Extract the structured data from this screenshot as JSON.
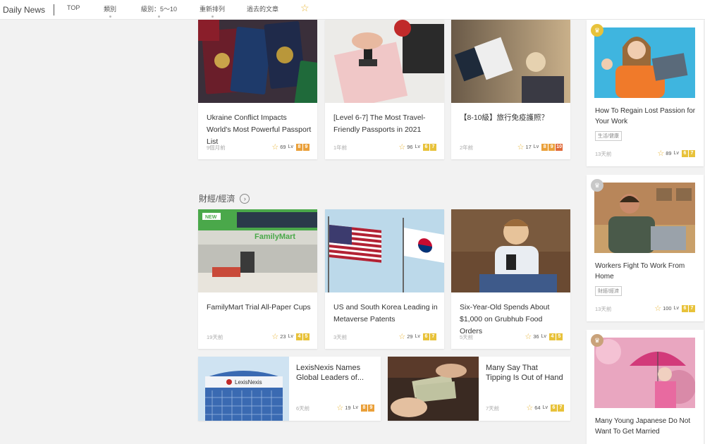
{
  "nav": {
    "brand": "Daily News",
    "items": [
      "TOP",
      "類別",
      "級別：5～10",
      "重新排列",
      "過去的文章"
    ],
    "star": "☆"
  },
  "top_cards": [
    {
      "title": "Ukraine Conflict Impacts World's Most Powerful Passport List",
      "ago": "9個月前",
      "rating": "69",
      "levels": [
        "8",
        "9"
      ]
    },
    {
      "title": "[Level 6-7] The Most Travel-Friendly Passports in 2021",
      "ago": "1年前",
      "rating": "96",
      "levels": [
        "6",
        "7"
      ]
    },
    {
      "title": "【8-10級】旅行免疫護照？",
      "ago": "2年前",
      "rating": "17",
      "levels": [
        "8",
        "9",
        "10"
      ]
    }
  ],
  "section": {
    "title": "財經/經濟",
    "arrow": "›"
  },
  "finance_cards": [
    {
      "title": "FamilyMart Trial All-Paper Cups",
      "ago": "19天前",
      "rating": "23",
      "levels": [
        "4",
        "5"
      ],
      "img_label": "NEW",
      "img_sign": "FamilyMart"
    },
    {
      "title": "US and South Korea Leading in Metaverse Patents",
      "ago": "3天前",
      "rating": "29",
      "levels": [
        "6",
        "7"
      ]
    },
    {
      "title": "Six-Year-Old Spends About $1,000 on Grubhub Food Orders",
      "ago": "5天前",
      "rating": "36",
      "levels": [
        "4",
        "5"
      ]
    }
  ],
  "wide_cards": [
    {
      "title": "LexisNexis Names Global Leaders of...",
      "ago": "6天前",
      "rating": "19",
      "levels": [
        "8",
        "9"
      ],
      "img_sign": "LexisNexis"
    },
    {
      "title": "Many Say That Tipping Is Out of Hand",
      "ago": "7天前",
      "rating": "64",
      "levels": [
        "6",
        "7"
      ]
    }
  ],
  "side_cards": [
    {
      "title": "How To Regain Lost Passion for Your Work",
      "tag": "生活/健康",
      "ago": "13天前",
      "rating": "89",
      "levels": [
        "6",
        "7"
      ],
      "crown_color": "#e8c23a"
    },
    {
      "title": "Workers Fight To Work From Home",
      "tag": "財經/經濟",
      "ago": "13天前",
      "rating": "100",
      "levels": [
        "6",
        "7"
      ],
      "crown_color": "#c8c8c8"
    },
    {
      "title": "Many Young Japanese Do Not Want To Get Married",
      "crown_color": "#c9a27a"
    }
  ],
  "colors": {
    "accent_star": "#e8b63a",
    "badge_orange": "#eaa03a",
    "badge_gold": "#e8c23a",
    "badge_red": "#e06a3a"
  }
}
